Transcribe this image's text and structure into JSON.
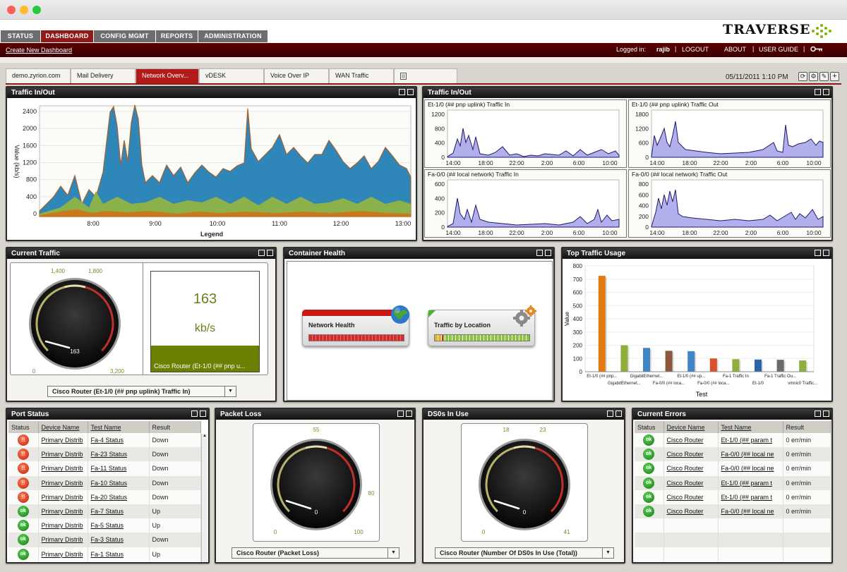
{
  "header": {
    "logo_text": "TRAVERSE",
    "nav": [
      "STATUS",
      "DASHBOARD",
      "CONFIG MGMT",
      "REPORTS",
      "ADMINISTRATION"
    ],
    "create_link": "Create New Dashboard",
    "logged_in_label": "Logged in:",
    "user": "rajib",
    "logout": "LOGOUT",
    "about": "ABOUT",
    "user_guide": "USER GUIDE"
  },
  "tabs": [
    "demo.zyrion.com",
    "Mail Delivery",
    "Network Overv...",
    "vDESK",
    "Voice Over IP",
    "WAN Traffic"
  ],
  "datetime": "05/11/2011 1:10 PM",
  "traffic_main": {
    "title": "Traffic In/Out",
    "ylabel": "Value (kb/s)",
    "legend": "Legend",
    "yticks": [
      "0",
      "400",
      "800",
      "1200",
      "1600",
      "2000",
      "2400"
    ],
    "xticks": [
      "8:00",
      "9:00",
      "10:00",
      "11:00",
      "12:00",
      "13:00"
    ]
  },
  "traffic_small": {
    "title": "Traffic In/Out",
    "charts": [
      {
        "title": "Et-1/0 (## pnp uplink) Traffic In",
        "yticks": [
          "0",
          "400",
          "800",
          "1200"
        ],
        "xticks": [
          "14:00",
          "18:00",
          "22:00",
          "2:00",
          "6:00",
          "10:00"
        ]
      },
      {
        "title": "Et-1/0 (## pnp uplink) Traffic Out",
        "yticks": [
          "0",
          "600",
          "1200",
          "1800"
        ],
        "xticks": [
          "14:00",
          "18:00",
          "22:00",
          "2:00",
          "6:00",
          "10:00"
        ]
      },
      {
        "title": "Fa-0/0 (## local network) Traffic In",
        "yticks": [
          "0",
          "200",
          "400",
          "600"
        ],
        "xticks": [
          "14:00",
          "18:00",
          "22:00",
          "2:00",
          "6:00",
          "10:00"
        ]
      },
      {
        "title": "Fa-0/0 (## local network) Traffic Out",
        "yticks": [
          "0",
          "200",
          "400",
          "600",
          "800"
        ],
        "xticks": [
          "14:00",
          "18:00",
          "22:00",
          "2:00",
          "6:00",
          "10:00"
        ]
      }
    ]
  },
  "current_traffic": {
    "title": "Current Traffic",
    "gauge_labels": {
      "min": "0",
      "max": "3,200",
      "warn": "1,400",
      "crit": "1,800",
      "value": "163"
    },
    "gauge_fraction": 0.05,
    "big_value": "163",
    "unit": "kb/s",
    "device_label": "Cisco Router (Et-1/0 (## pnp u...",
    "select": "Cisco Router (Et-1/0 (## pnp uplink) Traffic In)"
  },
  "container_health": {
    "title": "Container Health",
    "items": [
      {
        "label": "Network Health",
        "fill": 1.0,
        "color": "#d42a2a"
      },
      {
        "label": "Traffic by Location",
        "fill": 1.0,
        "color": "#8cc63f"
      }
    ]
  },
  "top_traffic": {
    "title": "Top Traffic Usage",
    "ylabel": "Value",
    "xlabel": "Test"
  },
  "chart_data": {
    "type": "bar",
    "title": "Top Traffic Usage",
    "xlabel": "Test",
    "ylabel": "Value",
    "ylim": [
      0,
      800
    ],
    "yticks": [
      "0",
      "100",
      "200",
      "300",
      "400",
      "500",
      "600",
      "700",
      "800"
    ],
    "categories": [
      "Et-1/0 (## pnp...",
      "GigabitEthernet...",
      "GigabitEthernet...",
      "Fa-0/0 (## loca...",
      "Et-1/0 (## up...",
      "Fa-0/0 (## loca...",
      "Fa-1 Traffic In",
      "Et-1/0",
      "Fa-1 Traffic Ou...",
      "vmnic0 Traffic..."
    ],
    "values": [
      725,
      200,
      180,
      158,
      155,
      100,
      95,
      92,
      90,
      85
    ],
    "colors": [
      "#e07b10",
      "#8fae3c",
      "#3f86c6",
      "#8a5a3a",
      "#3f86c6",
      "#d9502a",
      "#8fae3c",
      "#2a64a8",
      "#6b6b6b",
      "#8fae3c"
    ]
  },
  "port_status": {
    "title": "Port Status",
    "columns": [
      "Status",
      "Device Name",
      "Test Name",
      "Result"
    ],
    "rows": [
      {
        "status": "down",
        "device": "Primary Distrib",
        "test": "Fa-4 Status",
        "result": "Down"
      },
      {
        "status": "down",
        "device": "Primary Distrib",
        "test": "Fa-23 Status",
        "result": "Down"
      },
      {
        "status": "down",
        "device": "Primary Distrib",
        "test": "Fa-11 Status",
        "result": "Down"
      },
      {
        "status": "down",
        "device": "Primary Distrib",
        "test": "Fa-10 Status",
        "result": "Down"
      },
      {
        "status": "down",
        "device": "Primary Distrib",
        "test": "Fa-20 Status",
        "result": "Down"
      },
      {
        "status": "ok",
        "device": "Primary Distrib",
        "test": "Fa-7 Status",
        "result": "Up"
      },
      {
        "status": "ok",
        "device": "Primary Distrib",
        "test": "Fa-5 Status",
        "result": "Up"
      },
      {
        "status": "ok",
        "device": "Primary Distrib",
        "test": "Fa-3 Status",
        "result": "Down"
      },
      {
        "status": "ok",
        "device": "Primary Distrib",
        "test": "Fa-1 Status",
        "result": "Up"
      }
    ]
  },
  "packet_loss": {
    "title": "Packet Loss",
    "gauge_labels": {
      "min": "0",
      "max": "100",
      "warn": "55",
      "crit": "80",
      "value": "0"
    },
    "gauge_fraction": 0.0,
    "select": "Cisco Router (Packet Loss)"
  },
  "ds0": {
    "title": "DS0s In Use",
    "gauge_labels": {
      "min": "0",
      "max": "41",
      "warn": "18",
      "crit": "23",
      "value": "0"
    },
    "gauge_fraction": 0.0,
    "select": "Cisco Router (Number Of DS0s In Use (Total))"
  },
  "errors": {
    "title": "Current Errors",
    "columns": [
      "Status",
      "Device Name",
      "Test Name",
      "Result"
    ],
    "rows": [
      {
        "device": "Cisco Router",
        "test": "Et-1/0 (## param t",
        "result": "0 err/min"
      },
      {
        "device": "Cisco Router",
        "test": "Fa-0/0 (## local ne",
        "result": "0 err/min"
      },
      {
        "device": "Cisco Router",
        "test": "Fa-0/0 (## local ne",
        "result": "0 err/min"
      },
      {
        "device": "Cisco Router",
        "test": "Et-1/0 (## param t",
        "result": "0 err/min"
      },
      {
        "device": "Cisco Router",
        "test": "Et-1/0 (## param t",
        "result": "0 err/min"
      },
      {
        "device": "Cisco Router",
        "test": "Fa-0/0 (## local ne",
        "result": "0 err/min"
      }
    ],
    "ok_label": "ok"
  },
  "status_glyphs": {
    "down": "!!",
    "ok": "ok"
  }
}
